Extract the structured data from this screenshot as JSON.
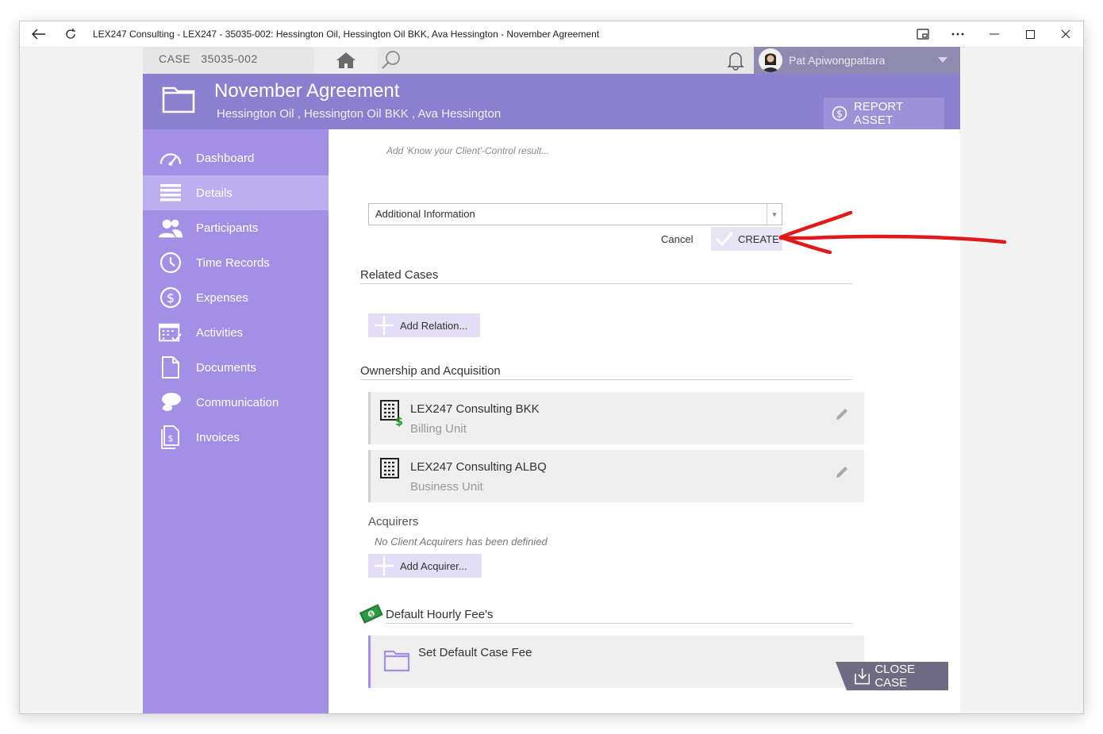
{
  "window": {
    "title": "LEX247 Consulting - LEX247 - 35035-002: Hessington Oil, Hessington Oil BKK, Ava Hessington - November Agreement"
  },
  "topbar": {
    "case_label": "CASE",
    "case_number": "35035-002",
    "user_name": "Pat Apiwongpattara"
  },
  "header": {
    "title": "November Agreement",
    "subtitle": "Hessington Oil ,  Hessington Oil BKK ,  Ava Hessington",
    "report_asset": "REPORT ASSET"
  },
  "sidebar": {
    "items": [
      {
        "label": "Dashboard",
        "icon": "gauge-icon"
      },
      {
        "label": "Details",
        "icon": "list-icon"
      },
      {
        "label": "Participants",
        "icon": "people-icon"
      },
      {
        "label": "Time Records",
        "icon": "clock-icon"
      },
      {
        "label": "Expenses",
        "icon": "dollar-circle-icon"
      },
      {
        "label": "Activities",
        "icon": "calendar-icon"
      },
      {
        "label": "Documents",
        "icon": "document-icon"
      },
      {
        "label": "Communication",
        "icon": "chat-icon"
      },
      {
        "label": "Invoices",
        "icon": "invoice-icon"
      }
    ],
    "active_index": 1
  },
  "content": {
    "kyc_placeholder": "Add 'Know your Client'-Control result...",
    "dropdown_value": "Additional Information",
    "cancel_label": "Cancel",
    "create_label": "CREATE",
    "related_cases": {
      "heading": "Related Cases",
      "add_label": "Add Relation..."
    },
    "ownership": {
      "heading": "Ownership and Acquisition",
      "units": [
        {
          "name": "LEX247 Consulting BKK",
          "type": "Billing Unit"
        },
        {
          "name": "LEX247 Consulting ALBQ",
          "type": "Business Unit"
        }
      ],
      "acquirers_label": "Acquirers",
      "acquirers_note": "No Client Acquirers has been definied",
      "add_acquirer_label": "Add Acquirer..."
    },
    "fees": {
      "heading": "Default Hourly Fee's",
      "set_fee_label": "Set Default Case Fee"
    }
  },
  "close_case": "CLOSE CASE",
  "colors": {
    "header": "#8b7fd0",
    "sidebar": "#a38fe6",
    "sidebar_active": "#bcaff0",
    "annotation_arrow": "#e0191b"
  }
}
